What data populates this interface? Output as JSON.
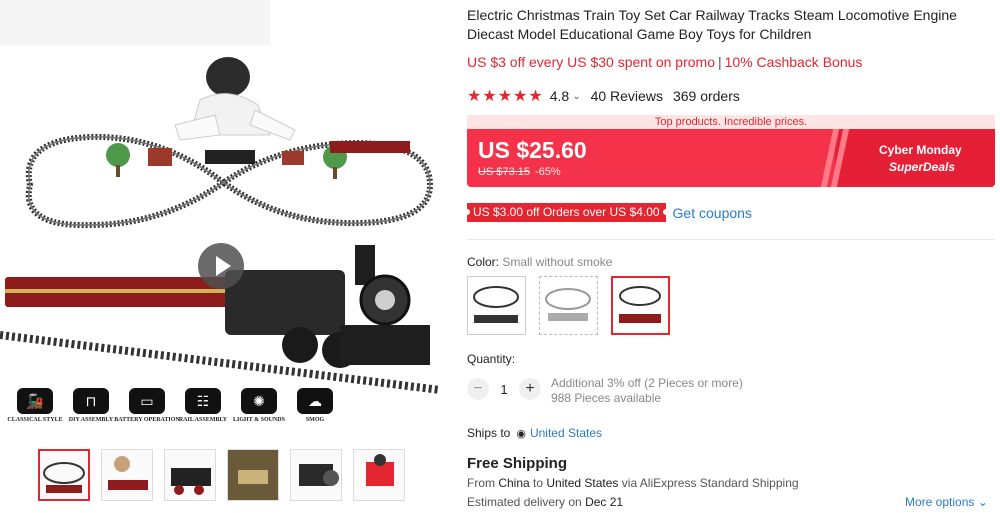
{
  "product": {
    "title": "Electric Christmas Train Toy Set Car Railway Tracks Steam Locomotive Engine Diecast Model Educational Game Boy Toys for Children",
    "promo_offer": "US $3 off every US $30 spent on promo",
    "promo_cashback": "10% Cashback Bonus"
  },
  "rating": {
    "stars": "★★★★★",
    "value": "4.8",
    "reviews": "40 Reviews",
    "orders": "369 orders"
  },
  "pricing": {
    "banner": "Top products. Incredible prices.",
    "price": "US $25.60",
    "original_price": "US $73.15",
    "discount": "-65%",
    "deal_line1": "Cyber Monday",
    "deal_line2": "SuperDeals"
  },
  "coupon": {
    "label": "US $3.00 off Orders over US $4.00",
    "get_coupons": "Get coupons"
  },
  "variants": {
    "label": "Color: ",
    "selected": "Small without smoke",
    "count": 3
  },
  "quantity": {
    "label": "Quantity:",
    "minus": "−",
    "plus": "+",
    "value": "1",
    "discount_note": "Additional 3% off (2 Pieces or more)",
    "available": "988 Pieces available"
  },
  "shipping": {
    "ships_to_label": "Ships to",
    "country": "United States",
    "free_shipping": "Free Shipping",
    "from_prefix": "From ",
    "from_country": "China",
    "to_word": " to ",
    "to_country": "United States",
    "via": " via AliExpress Standard Shipping",
    "delivery_prefix": "Estimated delivery on ",
    "delivery_date": "Dec 21",
    "more_options": "More options"
  },
  "gallery": {
    "features": [
      {
        "caption": "CLASSICAL STYLE",
        "icon": "locomotive-icon"
      },
      {
        "caption": "DIY ASSEMBLY",
        "icon": "track-icon"
      },
      {
        "caption": "BATTERY OPERATION",
        "icon": "battery-icon"
      },
      {
        "caption": "RAIL ASSEMBLY",
        "icon": "rail-icon"
      },
      {
        "caption": "LIGHT & SOUNDS",
        "icon": "light-icon"
      },
      {
        "caption": "SMOG",
        "icon": "smoke-icon"
      }
    ],
    "thumbnail_count": 6
  },
  "colors": {
    "accent": "#e3262f",
    "price_bg": "#f4334a",
    "link": "#2a7cc7"
  }
}
